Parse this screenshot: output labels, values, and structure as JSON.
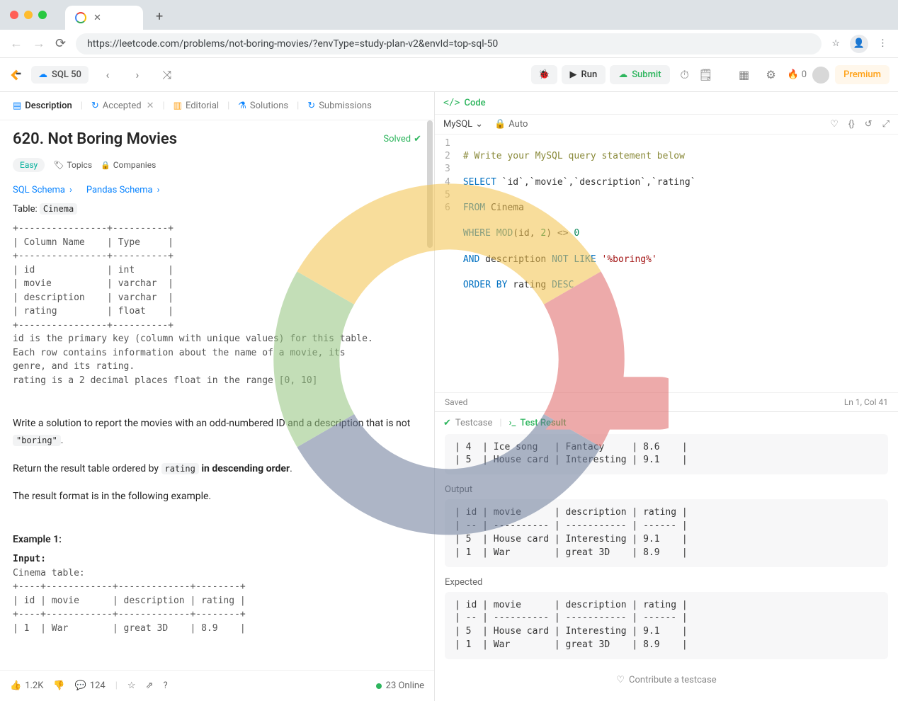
{
  "browser": {
    "url": "https://leetcode.com/problems/not-boring-movies/?envType=study-plan-v2&envId=top-sql-50",
    "new_tab": "+",
    "tab_close": "✕"
  },
  "app": {
    "plan_label": "SQL 50",
    "run": "Run",
    "submit": "Submit",
    "flame_count": "0",
    "premium": "Premium"
  },
  "tabs": {
    "description": "Description",
    "accepted": "Accepted",
    "editorial": "Editorial",
    "solutions": "Solutions",
    "submissions": "Submissions"
  },
  "problem": {
    "title": "620. Not Boring Movies",
    "solved": "Solved",
    "difficulty": "Easy",
    "topics": "Topics",
    "companies": "Companies",
    "sql_schema": "SQL Schema",
    "pandas_schema": "Pandas Schema",
    "table_label": "Table:",
    "table_name": "Cinema",
    "schema": "+----------------+----------+\n| Column Name    | Type     |\n+----------------+----------+\n| id             | int      |\n| movie          | varchar  |\n| description    | varchar  |\n| rating         | float    |\n+----------------+----------+\nid is the primary key (column with unique values) for this table.\nEach row contains information about the name of a movie, its\ngenre, and its rating.\nrating is a 2 decimal places float in the range [0, 10]",
    "para1_a": "Write a solution to report the movies with an odd-numbered ID and a description that is not ",
    "para1_code": "\"boring\"",
    "para1_b": ".",
    "para2_a": "Return the result table ordered by ",
    "para2_code": "rating",
    "para2_b": " in descending order",
    "para2_c": ".",
    "para3": "The result format is in the following example.",
    "example_title": "Example 1:",
    "example_input_label": "Input:",
    "example_input": "Cinema table:\n+----+------------+-------------+--------+\n| id | movie      | description | rating |\n+----+------------+-------------+--------+\n| 1  | War        | great 3D    | 8.9    |"
  },
  "footer": {
    "likes": "1.2K",
    "comments": "124",
    "online": "23 Online"
  },
  "code": {
    "header": "Code",
    "language": "MySQL",
    "auto": "Auto",
    "saved": "Saved",
    "cursor": "Ln 1, Col 41",
    "lines": [
      {
        "n": "1",
        "t": "# Write your MySQL query statement below",
        "cls": "c-comment"
      },
      {
        "n": "2"
      },
      {
        "n": "3"
      },
      {
        "n": "4"
      },
      {
        "n": "5"
      },
      {
        "n": "6"
      }
    ],
    "l2": {
      "kw": "SELECT",
      "rest": " `id`,`movie`,`description`,`rating`"
    },
    "l3": {
      "kw": "FROM",
      "rest": " Cinema"
    },
    "l4": {
      "kw": "WHERE ",
      "fn": "MOD",
      "rest1": "(id, ",
      "num": "2",
      "rest2": ") ",
      "op": "<>",
      "rest3": " ",
      "num2": "0"
    },
    "l5": {
      "kw": "AND",
      "rest1": " description ",
      "kw2": "NOT LIKE",
      "rest2": " ",
      "str": "'%boring%'"
    },
    "l6": {
      "kw": "ORDER BY",
      "rest": " rating ",
      "kw2": "DESC"
    }
  },
  "results": {
    "testcase_tab": "Testcase",
    "testresult_tab": "Test Result",
    "input_tail": "| 4  | Ice song   | Fantacy     | 8.6    |\n| 5  | House card | Interesting | 9.1    |",
    "output_label": "Output",
    "output": "| id | movie      | description | rating |\n| -- | ---------- | ----------- | ------ |\n| 5  | House card | Interesting | 9.1    |\n| 1  | War        | great 3D    | 8.9    |",
    "expected_label": "Expected",
    "expected": "| id | movie      | description | rating |\n| -- | ---------- | ----------- | ------ |\n| 5  | House card | Interesting | 9.1    |\n| 1  | War        | great 3D    | 8.9    |",
    "contribute": "Contribute a testcase"
  }
}
